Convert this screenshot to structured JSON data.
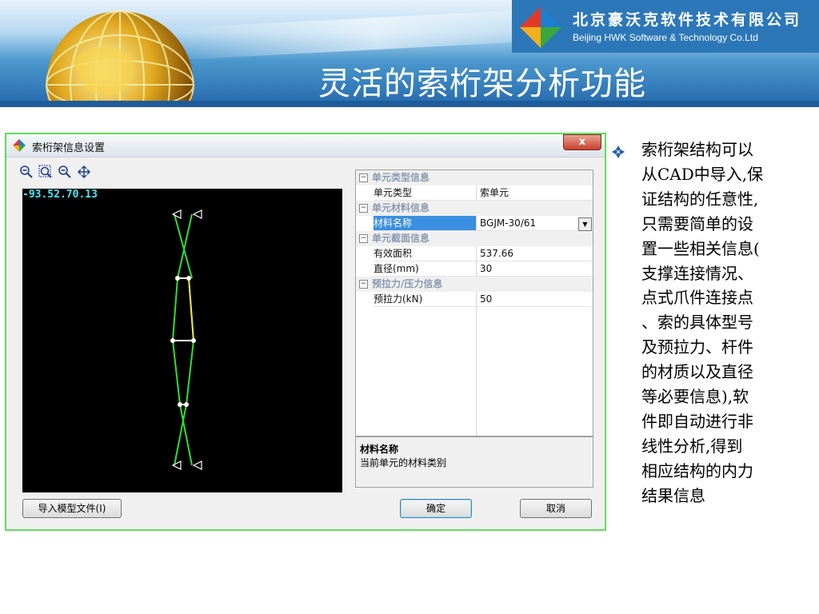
{
  "header": {
    "company_cn": "北京豪沃克软件技术有限公司",
    "company_en": "Beijing HWK Software & Technology Co.Ltd",
    "slide_title": "灵活的索桁架分析功能"
  },
  "dialog": {
    "title": "索桁架信息设置",
    "close_label": "x",
    "toolbar": {
      "icons": [
        "zoom-out-icon",
        "zoom-fit-icon",
        "zoom-in-icon",
        "pan-icon"
      ]
    },
    "canvas": {
      "coordinate_readout": "-93.52.70.13"
    },
    "property_grid": {
      "categories": [
        {
          "label": "单元类型信息",
          "rows": [
            {
              "name": "单元类型",
              "value": "索单元"
            }
          ]
        },
        {
          "label": "单元材料信息",
          "rows": [
            {
              "name": "材料名称",
              "value": "BGJM-30/61",
              "selected": true,
              "dropdown": true
            }
          ]
        },
        {
          "label": "单元截面信息",
          "rows": [
            {
              "name": "有效面积",
              "value": "537.66"
            },
            {
              "name": "直径(mm)",
              "value": "30"
            }
          ]
        },
        {
          "label": "预拉力/压力信息",
          "rows": [
            {
              "name": "预拉力(kN)",
              "value": "50"
            }
          ]
        }
      ],
      "expander_symbol": "−",
      "dropdown_symbol": "▼"
    },
    "description": {
      "title": "材料名称",
      "text": "当前单元的材料类别"
    },
    "buttons": {
      "import": "导入模型文件(I)",
      "ok": "确定",
      "cancel": "取消"
    }
  },
  "bullet": {
    "lines": [
      "索桁架结构可以",
      "从CAD中导入,保",
      "证结构的任意性,",
      "只需要简单的设",
      "置一些相关信息(",
      "支撑连接情况、",
      "点式爪件连接点",
      "、索的具体型号",
      "及预拉力、杆件",
      "的材质以及直径",
      "等必要信息),软",
      "件即自动进行非",
      "线性分析,得到",
      "相应结构的内力",
      "结果信息"
    ]
  },
  "colors": {
    "banner_blue": "#2a6fb1",
    "dialog_border": "#5de05a",
    "cable_green": "#2ee02e",
    "strut_yellow": "#f2e24a",
    "coord_cyan": "#3cf0ff",
    "selection_blue": "#3a8fe0"
  }
}
